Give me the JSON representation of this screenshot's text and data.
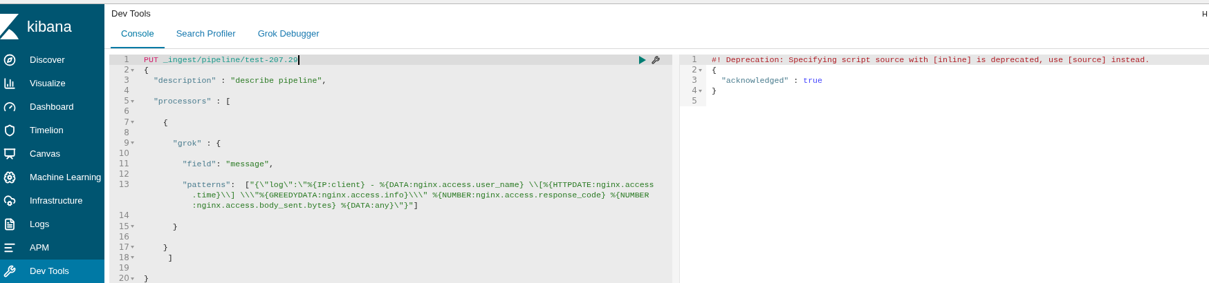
{
  "header": {
    "title": "Dev Tools",
    "corner": "H"
  },
  "sidebar": {
    "logo": "kibana",
    "items": [
      {
        "label": "Discover",
        "selected": false
      },
      {
        "label": "Visualize",
        "selected": false
      },
      {
        "label": "Dashboard",
        "selected": false
      },
      {
        "label": "Timelion",
        "selected": false
      },
      {
        "label": "Canvas",
        "selected": false
      },
      {
        "label": "Machine Learning",
        "selected": false
      },
      {
        "label": "Infrastructure",
        "selected": false
      },
      {
        "label": "Logs",
        "selected": false
      },
      {
        "label": "APM",
        "selected": false
      },
      {
        "label": "Dev Tools",
        "selected": true
      }
    ]
  },
  "tabs": [
    {
      "label": "Console",
      "selected": true
    },
    {
      "label": "Search Profiler",
      "selected": false
    },
    {
      "label": "Grok Debugger",
      "selected": false
    }
  ],
  "editor": {
    "lines": [
      {
        "number": "1",
        "foldable": false,
        "active": true,
        "rows": [
          [
            {
              "kind": "method",
              "text": "PUT"
            },
            {
              "kind": "punct",
              "text": " "
            },
            {
              "kind": "url",
              "text": "_ingest/pipeline/test-207.29"
            }
          ]
        ]
      },
      {
        "number": "2",
        "foldable": true,
        "active": false,
        "rows": [
          [
            {
              "kind": "punct",
              "text": "{"
            }
          ]
        ]
      },
      {
        "number": "3",
        "foldable": false,
        "active": false,
        "rows": [
          [
            {
              "kind": "key",
              "text": "  \"description\""
            },
            {
              "kind": "punct",
              "text": " : "
            },
            {
              "kind": "string",
              "text": "\"describe pipeline\""
            },
            {
              "kind": "punct",
              "text": ","
            }
          ]
        ]
      },
      {
        "number": "4",
        "foldable": false,
        "active": false,
        "rows": [
          []
        ]
      },
      {
        "number": "5",
        "foldable": true,
        "active": false,
        "rows": [
          [
            {
              "kind": "key",
              "text": "  \"processors\""
            },
            {
              "kind": "punct",
              "text": " : ["
            }
          ]
        ]
      },
      {
        "number": "6",
        "foldable": false,
        "active": false,
        "rows": [
          []
        ]
      },
      {
        "number": "7",
        "foldable": true,
        "active": false,
        "rows": [
          [
            {
              "kind": "punct",
              "text": "    {"
            }
          ]
        ]
      },
      {
        "number": "8",
        "foldable": false,
        "active": false,
        "rows": [
          []
        ]
      },
      {
        "number": "9",
        "foldable": true,
        "active": false,
        "rows": [
          [
            {
              "kind": "key",
              "text": "      \"grok\""
            },
            {
              "kind": "punct",
              "text": " : {"
            }
          ]
        ]
      },
      {
        "number": "10",
        "foldable": false,
        "active": false,
        "rows": [
          []
        ]
      },
      {
        "number": "11",
        "foldable": false,
        "active": false,
        "rows": [
          [
            {
              "kind": "key",
              "text": "        \"field\""
            },
            {
              "kind": "punct",
              "text": ": "
            },
            {
              "kind": "string",
              "text": "\"message\""
            },
            {
              "kind": "punct",
              "text": ","
            }
          ]
        ]
      },
      {
        "number": "12",
        "foldable": false,
        "active": false,
        "rows": [
          []
        ]
      },
      {
        "number": "13",
        "foldable": false,
        "active": false,
        "rows": [
          [
            {
              "kind": "key",
              "text": "        \"patterns\""
            },
            {
              "kind": "punct",
              "text": ":  ["
            },
            {
              "kind": "string",
              "text": "\"{\\\"log\\\":\\\"%{IP:client} - %{DATA:nginx.access.user_name} \\\\[%{HTTPDATE:nginx.access"
            },
            {
              "kind": "string",
              "wrap": true,
              "text": "          .time}\\\\] \\\\\\\"%{GREEDYDATA:nginx.access.info}\\\\\\\" %{NUMBER:nginx.access.response_code} %{NUMBER"
            },
            {
              "kind": "string",
              "wrap": true,
              "text": "          :nginx.access.body_sent.bytes} %{DATA:any}\\\"}\""
            },
            {
              "kind": "punct",
              "text": "]"
            }
          ]
        ]
      },
      {
        "number": "14",
        "foldable": false,
        "active": false,
        "rows": [
          []
        ]
      },
      {
        "number": "15",
        "foldable": true,
        "active": false,
        "rows": [
          [
            {
              "kind": "punct",
              "text": "      }"
            }
          ]
        ]
      },
      {
        "number": "16",
        "foldable": false,
        "active": false,
        "rows": [
          []
        ]
      },
      {
        "number": "17",
        "foldable": true,
        "active": false,
        "rows": [
          [
            {
              "kind": "punct",
              "text": "    }"
            }
          ]
        ]
      },
      {
        "number": "18",
        "foldable": true,
        "active": false,
        "rows": [
          [
            {
              "kind": "punct",
              "text": "     ]"
            }
          ]
        ]
      },
      {
        "number": "19",
        "foldable": false,
        "active": false,
        "rows": [
          []
        ]
      },
      {
        "number": "20",
        "foldable": true,
        "active": false,
        "rows": [
          [
            {
              "kind": "punct",
              "text": "}"
            }
          ]
        ]
      }
    ]
  },
  "response": {
    "lines": [
      {
        "number": "1",
        "foldable": false,
        "active": true,
        "rows": [
          [
            {
              "kind": "comment",
              "text": "#! Deprecation: Specifying script source with [inline] is deprecated, use [source] instead."
            }
          ]
        ]
      },
      {
        "number": "2",
        "foldable": true,
        "active": false,
        "rows": [
          [
            {
              "kind": "punct",
              "text": "{"
            }
          ]
        ]
      },
      {
        "number": "3",
        "foldable": false,
        "active": false,
        "rows": [
          [
            {
              "kind": "key",
              "text": "  \"acknowledged\""
            },
            {
              "kind": "punct",
              "text": " : "
            },
            {
              "kind": "literal",
              "text": "true"
            }
          ]
        ]
      },
      {
        "number": "4",
        "foldable": true,
        "active": false,
        "rows": [
          [
            {
              "kind": "punct",
              "text": "}"
            }
          ]
        ]
      },
      {
        "number": "5",
        "foldable": false,
        "active": false,
        "rows": [
          []
        ]
      }
    ]
  }
}
